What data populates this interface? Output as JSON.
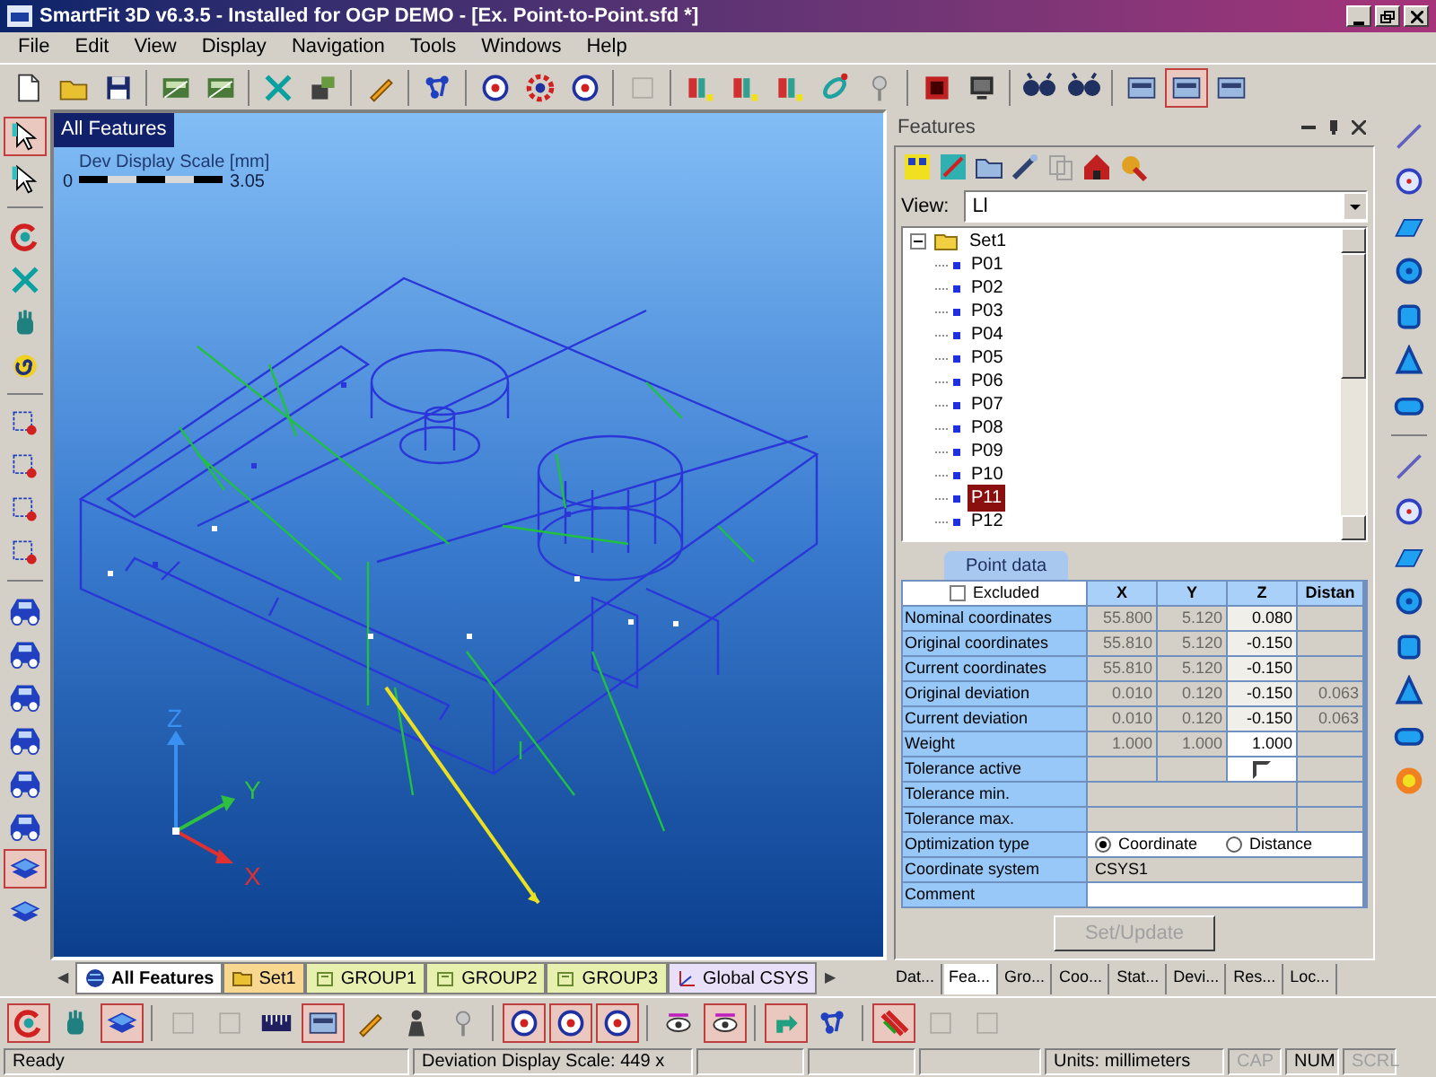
{
  "window": {
    "title": "SmartFit 3D v6.3.5 - Installed for OGP DEMO - [Ex. Point-to-Point.sfd *]"
  },
  "menu": [
    "File",
    "Edit",
    "View",
    "Display",
    "Navigation",
    "Tools",
    "Windows",
    "Help"
  ],
  "main_toolbar": [
    {
      "kind": "doc",
      "pressed": false
    },
    {
      "kind": "folder",
      "pressed": false
    },
    {
      "kind": "save",
      "pressed": false
    },
    {
      "kind": "sep"
    },
    {
      "kind": "scanner",
      "pressed": false
    },
    {
      "kind": "scanner",
      "pressed": false
    },
    {
      "kind": "sep"
    },
    {
      "kind": "cross",
      "pressed": false
    },
    {
      "kind": "probe",
      "pressed": false
    },
    {
      "kind": "sep"
    },
    {
      "kind": "pen",
      "pressed": false
    },
    {
      "kind": "sep"
    },
    {
      "kind": "nodes",
      "pressed": false
    },
    {
      "kind": "sep"
    },
    {
      "kind": "target",
      "pressed": false
    },
    {
      "kind": "gear",
      "pressed": false
    },
    {
      "kind": "target",
      "pressed": false
    },
    {
      "kind": "sep"
    },
    {
      "kind": "blank",
      "pressed": false
    },
    {
      "kind": "sep"
    },
    {
      "kind": "feature",
      "pressed": false
    },
    {
      "kind": "feature",
      "pressed": false
    },
    {
      "kind": "feature",
      "pressed": false
    },
    {
      "kind": "ring",
      "pressed": false
    },
    {
      "kind": "pin",
      "pressed": false
    },
    {
      "kind": "sep"
    },
    {
      "kind": "stop",
      "pressed": false
    },
    {
      "kind": "monitor",
      "pressed": false
    },
    {
      "kind": "sep"
    },
    {
      "kind": "glasses",
      "pressed": false
    },
    {
      "kind": "glasses",
      "pressed": false
    },
    {
      "kind": "sep"
    },
    {
      "kind": "view",
      "pressed": false
    },
    {
      "kind": "view",
      "pressed": true
    },
    {
      "kind": "view",
      "pressed": false
    }
  ],
  "left_toolbar": [
    {
      "kind": "cursor",
      "pressed": true
    },
    {
      "kind": "cursor",
      "pressed": false
    },
    {
      "kind": "sep"
    },
    {
      "kind": "rotate",
      "pressed": false
    },
    {
      "kind": "cross",
      "pressed": false
    },
    {
      "kind": "hand",
      "pressed": false
    },
    {
      "kind": "spiral",
      "pressed": false
    },
    {
      "kind": "sep"
    },
    {
      "kind": "zoom",
      "pressed": false
    },
    {
      "kind": "zoom",
      "pressed": false
    },
    {
      "kind": "zoom",
      "pressed": false
    },
    {
      "kind": "zoom",
      "pressed": false
    },
    {
      "kind": "sep"
    },
    {
      "kind": "car",
      "pressed": false
    },
    {
      "kind": "car",
      "pressed": false
    },
    {
      "kind": "car",
      "pressed": false
    },
    {
      "kind": "car",
      "pressed": false
    },
    {
      "kind": "car",
      "pressed": false
    },
    {
      "kind": "car",
      "pressed": false
    },
    {
      "kind": "layers",
      "pressed": true
    },
    {
      "kind": "layers",
      "pressed": false
    }
  ],
  "right_toolbar": [
    {
      "kind": "line",
      "pressed": false
    },
    {
      "kind": "circle",
      "pressed": false
    },
    {
      "kind": "plane",
      "pressed": false
    },
    {
      "kind": "sphere",
      "pressed": false
    },
    {
      "kind": "cylinder",
      "pressed": false
    },
    {
      "kind": "cone",
      "pressed": false
    },
    {
      "kind": "slot",
      "pressed": false
    },
    {
      "kind": "sep"
    },
    {
      "kind": "line",
      "pressed": false
    },
    {
      "kind": "circle",
      "pressed": false
    },
    {
      "kind": "plane",
      "pressed": false
    },
    {
      "kind": "sphere",
      "pressed": false
    },
    {
      "kind": "cylinder",
      "pressed": false
    },
    {
      "kind": "cone",
      "pressed": false
    },
    {
      "kind": "slot",
      "pressed": false
    },
    {
      "kind": "star",
      "pressed": false
    }
  ],
  "bottom_toolbar": [
    {
      "kind": "rotate",
      "pressed": true
    },
    {
      "kind": "hand",
      "pressed": false
    },
    {
      "kind": "layers",
      "pressed": true
    },
    {
      "kind": "sep"
    },
    {
      "kind": "blank",
      "pressed": false
    },
    {
      "kind": "blank",
      "pressed": false
    },
    {
      "kind": "ruler",
      "pressed": false
    },
    {
      "kind": "view",
      "pressed": true
    },
    {
      "kind": "pen",
      "pressed": false
    },
    {
      "kind": "person",
      "pressed": false
    },
    {
      "kind": "pin",
      "pressed": false
    },
    {
      "kind": "sep"
    },
    {
      "kind": "target",
      "pressed": true
    },
    {
      "kind": "target",
      "pressed": true
    },
    {
      "kind": "target",
      "pressed": true
    },
    {
      "kind": "sep"
    },
    {
      "kind": "eye",
      "pressed": false
    },
    {
      "kind": "eye",
      "pressed": true
    },
    {
      "kind": "sep"
    },
    {
      "kind": "arrow",
      "pressed": true
    },
    {
      "kind": "nodes",
      "pressed": false
    },
    {
      "kind": "sep"
    },
    {
      "kind": "stripes",
      "pressed": true
    },
    {
      "kind": "blank",
      "pressed": false
    },
    {
      "kind": "blank",
      "pressed": false
    }
  ],
  "viewport": {
    "label": "All Features",
    "scale_title": "Dev Display Scale [mm]",
    "scale_min": "0",
    "scale_max": "3.05",
    "axes": [
      "X",
      "Y",
      "Z"
    ]
  },
  "view_tabs": {
    "left": "◀",
    "right": "▶",
    "tabs": [
      {
        "label": "All Features",
        "kind": "all",
        "selected": true
      },
      {
        "label": "Set1",
        "kind": "set",
        "selected": false
      },
      {
        "label": "GROUP1",
        "kind": "group",
        "selected": false
      },
      {
        "label": "GROUP2",
        "kind": "group",
        "selected": false
      },
      {
        "label": "GROUP3",
        "kind": "group",
        "selected": false
      },
      {
        "label": "Global CSYS",
        "kind": "csys",
        "selected": false
      }
    ]
  },
  "features": {
    "title": "Features",
    "view_label": "View:",
    "view_value": "Ll",
    "tree": [
      {
        "label": "Set1",
        "expanded": true,
        "selected": false,
        "children": [
          {
            "label": "P01",
            "selected": false
          },
          {
            "label": "P02",
            "selected": false
          },
          {
            "label": "P03",
            "selected": false
          },
          {
            "label": "P04",
            "selected": false
          },
          {
            "label": "P05",
            "selected": false
          },
          {
            "label": "P06",
            "selected": false
          },
          {
            "label": "P07",
            "selected": false
          },
          {
            "label": "P08",
            "selected": false
          },
          {
            "label": "P09",
            "selected": false
          },
          {
            "label": "P10",
            "selected": false
          },
          {
            "label": "P11",
            "selected": true
          },
          {
            "label": "P12",
            "selected": false
          }
        ]
      }
    ],
    "point_tab": "Point data",
    "table": {
      "excluded": {
        "label": "Excluded",
        "checked": false
      },
      "columns": [
        "X",
        "Y",
        "Z",
        "Distan"
      ],
      "rows": [
        {
          "label": "Nominal coordinates",
          "cells": [
            {
              "value": "55.800",
              "disabled": true
            },
            {
              "value": "5.120",
              "disabled": true
            },
            {
              "value": "0.080",
              "disabled": false
            },
            {
              "disabled": true
            }
          ]
        },
        {
          "label": "Original coordinates",
          "cells": [
            {
              "value": "55.810",
              "disabled": true
            },
            {
              "value": "5.120",
              "disabled": true
            },
            {
              "value": "-0.150",
              "disabled": false
            },
            {
              "disabled": true
            }
          ]
        },
        {
          "label": "Current coordinates",
          "cells": [
            {
              "value": "55.810",
              "disabled": true
            },
            {
              "value": "5.120",
              "disabled": true
            },
            {
              "value": "-0.150",
              "disabled": false
            },
            {
              "disabled": true
            }
          ]
        },
        {
          "label": "Original deviation",
          "cells": [
            {
              "value": "0.010",
              "disabled": true
            },
            {
              "value": "0.120",
              "disabled": true
            },
            {
              "value": "-0.150",
              "disabled": false
            },
            {
              "value": "0.063",
              "disabled": true
            }
          ]
        },
        {
          "label": "Current deviation",
          "cells": [
            {
              "value": "0.010",
              "disabled": true
            },
            {
              "value": "0.120",
              "disabled": true
            },
            {
              "value": "-0.150",
              "disabled": false
            },
            {
              "value": "0.063",
              "disabled": true
            }
          ]
        },
        {
          "label": "Weight",
          "cells": [
            {
              "value": "1.000",
              "disabled": true
            },
            {
              "value": "1.000",
              "disabled": true
            },
            {
              "value": "1.000",
              "disabled": false,
              "kind": "input"
            },
            {
              "disabled": true
            }
          ]
        },
        {
          "label": "Tolerance active",
          "cells": [
            {
              "disabled": true
            },
            {
              "disabled": true
            },
            {
              "disabled": false,
              "kind": "check",
              "checked": false
            },
            {
              "disabled": true
            }
          ]
        },
        {
          "label": "Tolerance min.",
          "cells": []
        },
        {
          "label": "Tolerance max.",
          "cells": []
        }
      ],
      "optimization": {
        "label": "Optimization type",
        "options": [
          {
            "label": "Coordinate",
            "selected": true
          },
          {
            "label": "Distance",
            "selected": false
          }
        ]
      },
      "csys": {
        "label": "Coordinate system",
        "value": "CSYS1"
      },
      "comment": {
        "label": "Comment"
      }
    },
    "apply_button": {
      "label": "Set/Update",
      "disabled": true
    },
    "bottom_tabs": [
      {
        "label": "Dat...",
        "selected": false
      },
      {
        "label": "Fea...",
        "selected": true
      },
      {
        "label": "Gro...",
        "selected": false
      },
      {
        "label": "Coo...",
        "selected": false
      },
      {
        "label": "Stat...",
        "selected": false
      },
      {
        "label": "Devi...",
        "selected": false
      },
      {
        "label": "Res...",
        "selected": false
      },
      {
        "label": "Loc...",
        "selected": false
      }
    ]
  },
  "status_bar": {
    "message": "Ready",
    "scale": "Deviation Display Scale: 449 x",
    "units": "Units: millimeters",
    "indicators": [
      {
        "label": "CAP",
        "on": false
      },
      {
        "label": "NUM",
        "on": true
      },
      {
        "label": "SCRL",
        "on": false
      }
    ]
  }
}
